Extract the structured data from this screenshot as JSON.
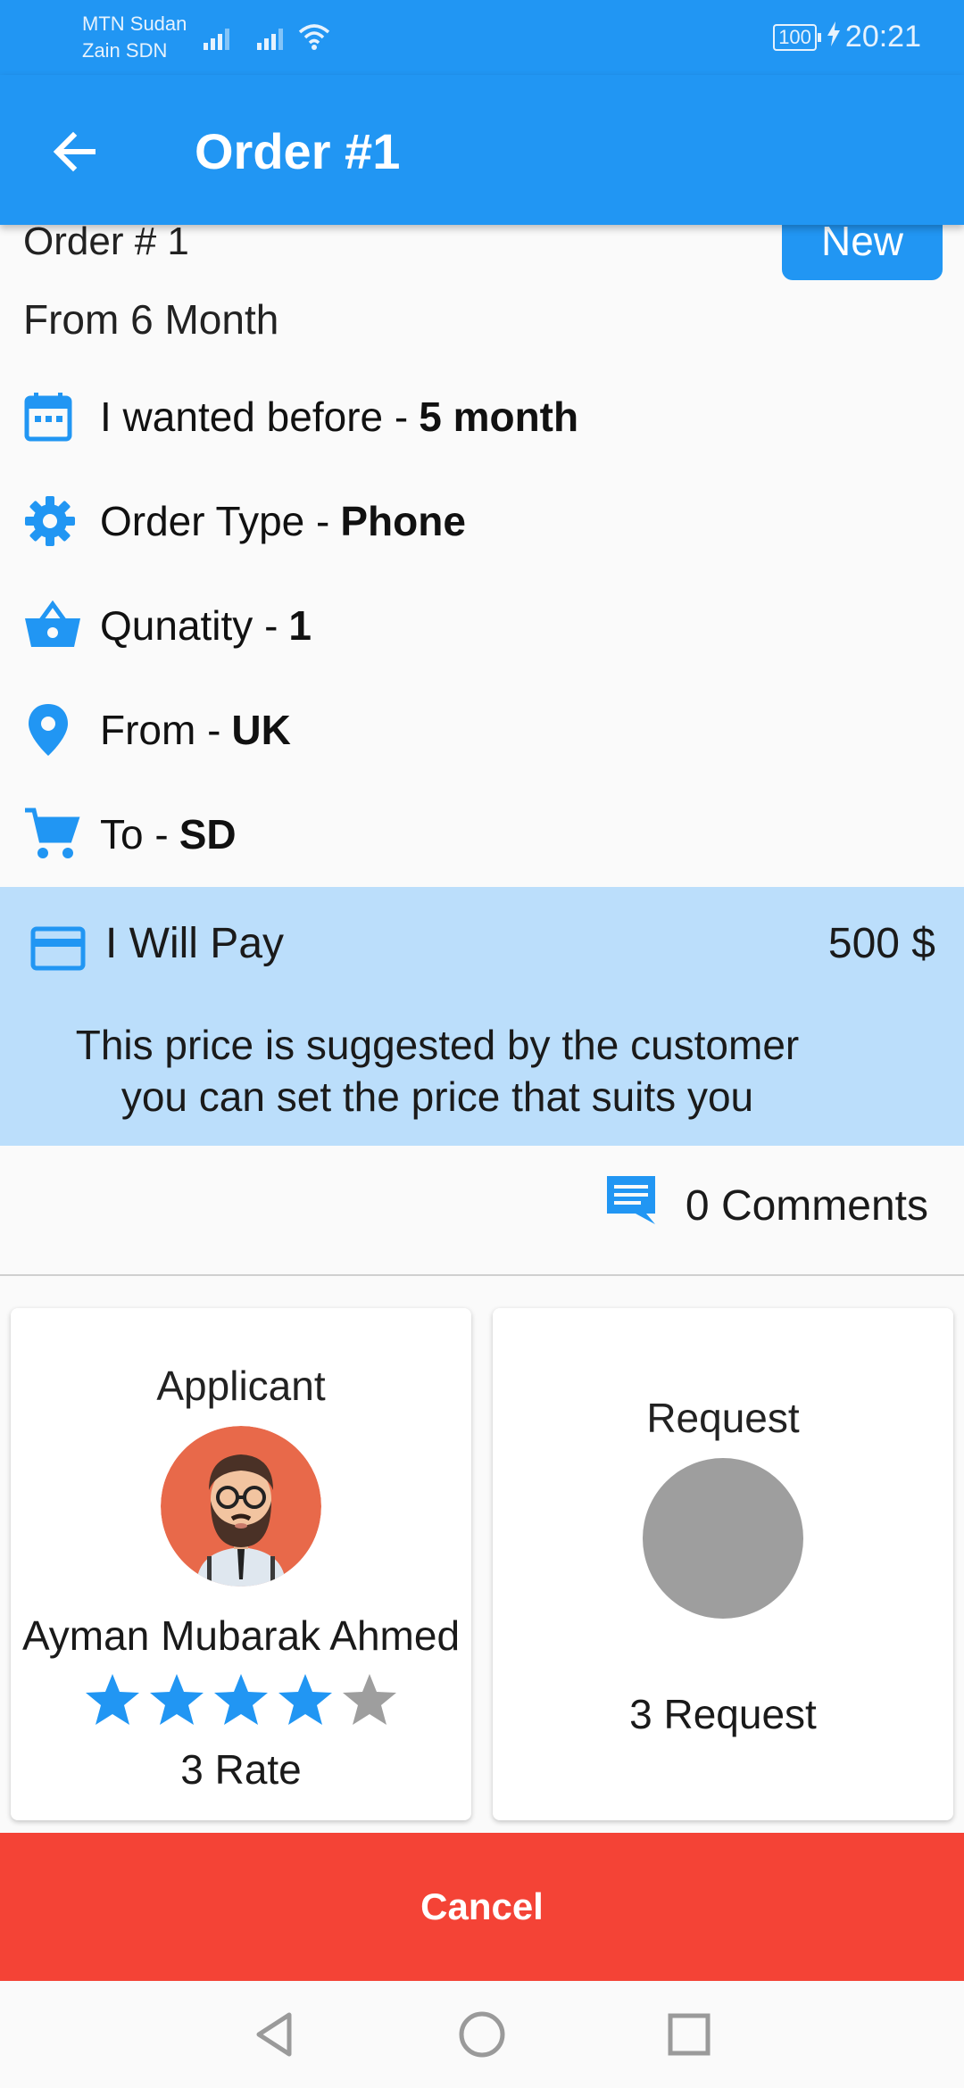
{
  "status_bar": {
    "carrier_1": "MTN Sudan",
    "carrier_2": "Zain SDN",
    "battery": "100",
    "time": "20:21"
  },
  "app_bar": {
    "title": "Order #1"
  },
  "order": {
    "number_label": "Order # 1",
    "status_badge": "New",
    "from_label": "From 6 Month",
    "rows": [
      {
        "label": "I wanted before - ",
        "value": "5 month",
        "icon": "calendar-icon"
      },
      {
        "label": "Order Type - ",
        "value": "Phone",
        "icon": "gear-icon"
      },
      {
        "label": "Qunatity - ",
        "value": "1",
        "icon": "basket-icon"
      },
      {
        "label": "From - ",
        "value": "UK",
        "icon": "location-pin-icon"
      },
      {
        "label": "To - ",
        "value": "SD",
        "icon": "cart-icon"
      }
    ]
  },
  "payment": {
    "label": "I Will Pay",
    "amount": "500 $",
    "note_line1": "This price is suggested by the customer",
    "note_line2": "you can set the price that suits you"
  },
  "comments": {
    "label": "0 Comments"
  },
  "applicant_card": {
    "title": "Applicant",
    "name": "Ayman Mubarak Ahmed",
    "rating_value": 4,
    "rating_max": 5,
    "rate_label": "3 Rate"
  },
  "request_card": {
    "title": "Request",
    "count_label": "3 Request"
  },
  "actions": {
    "cancel_label": "Cancel"
  },
  "colors": {
    "primary": "#2196f3",
    "pay_background": "#bbdefb",
    "cancel": "#f44336",
    "star_inactive": "#9e9e9e"
  }
}
